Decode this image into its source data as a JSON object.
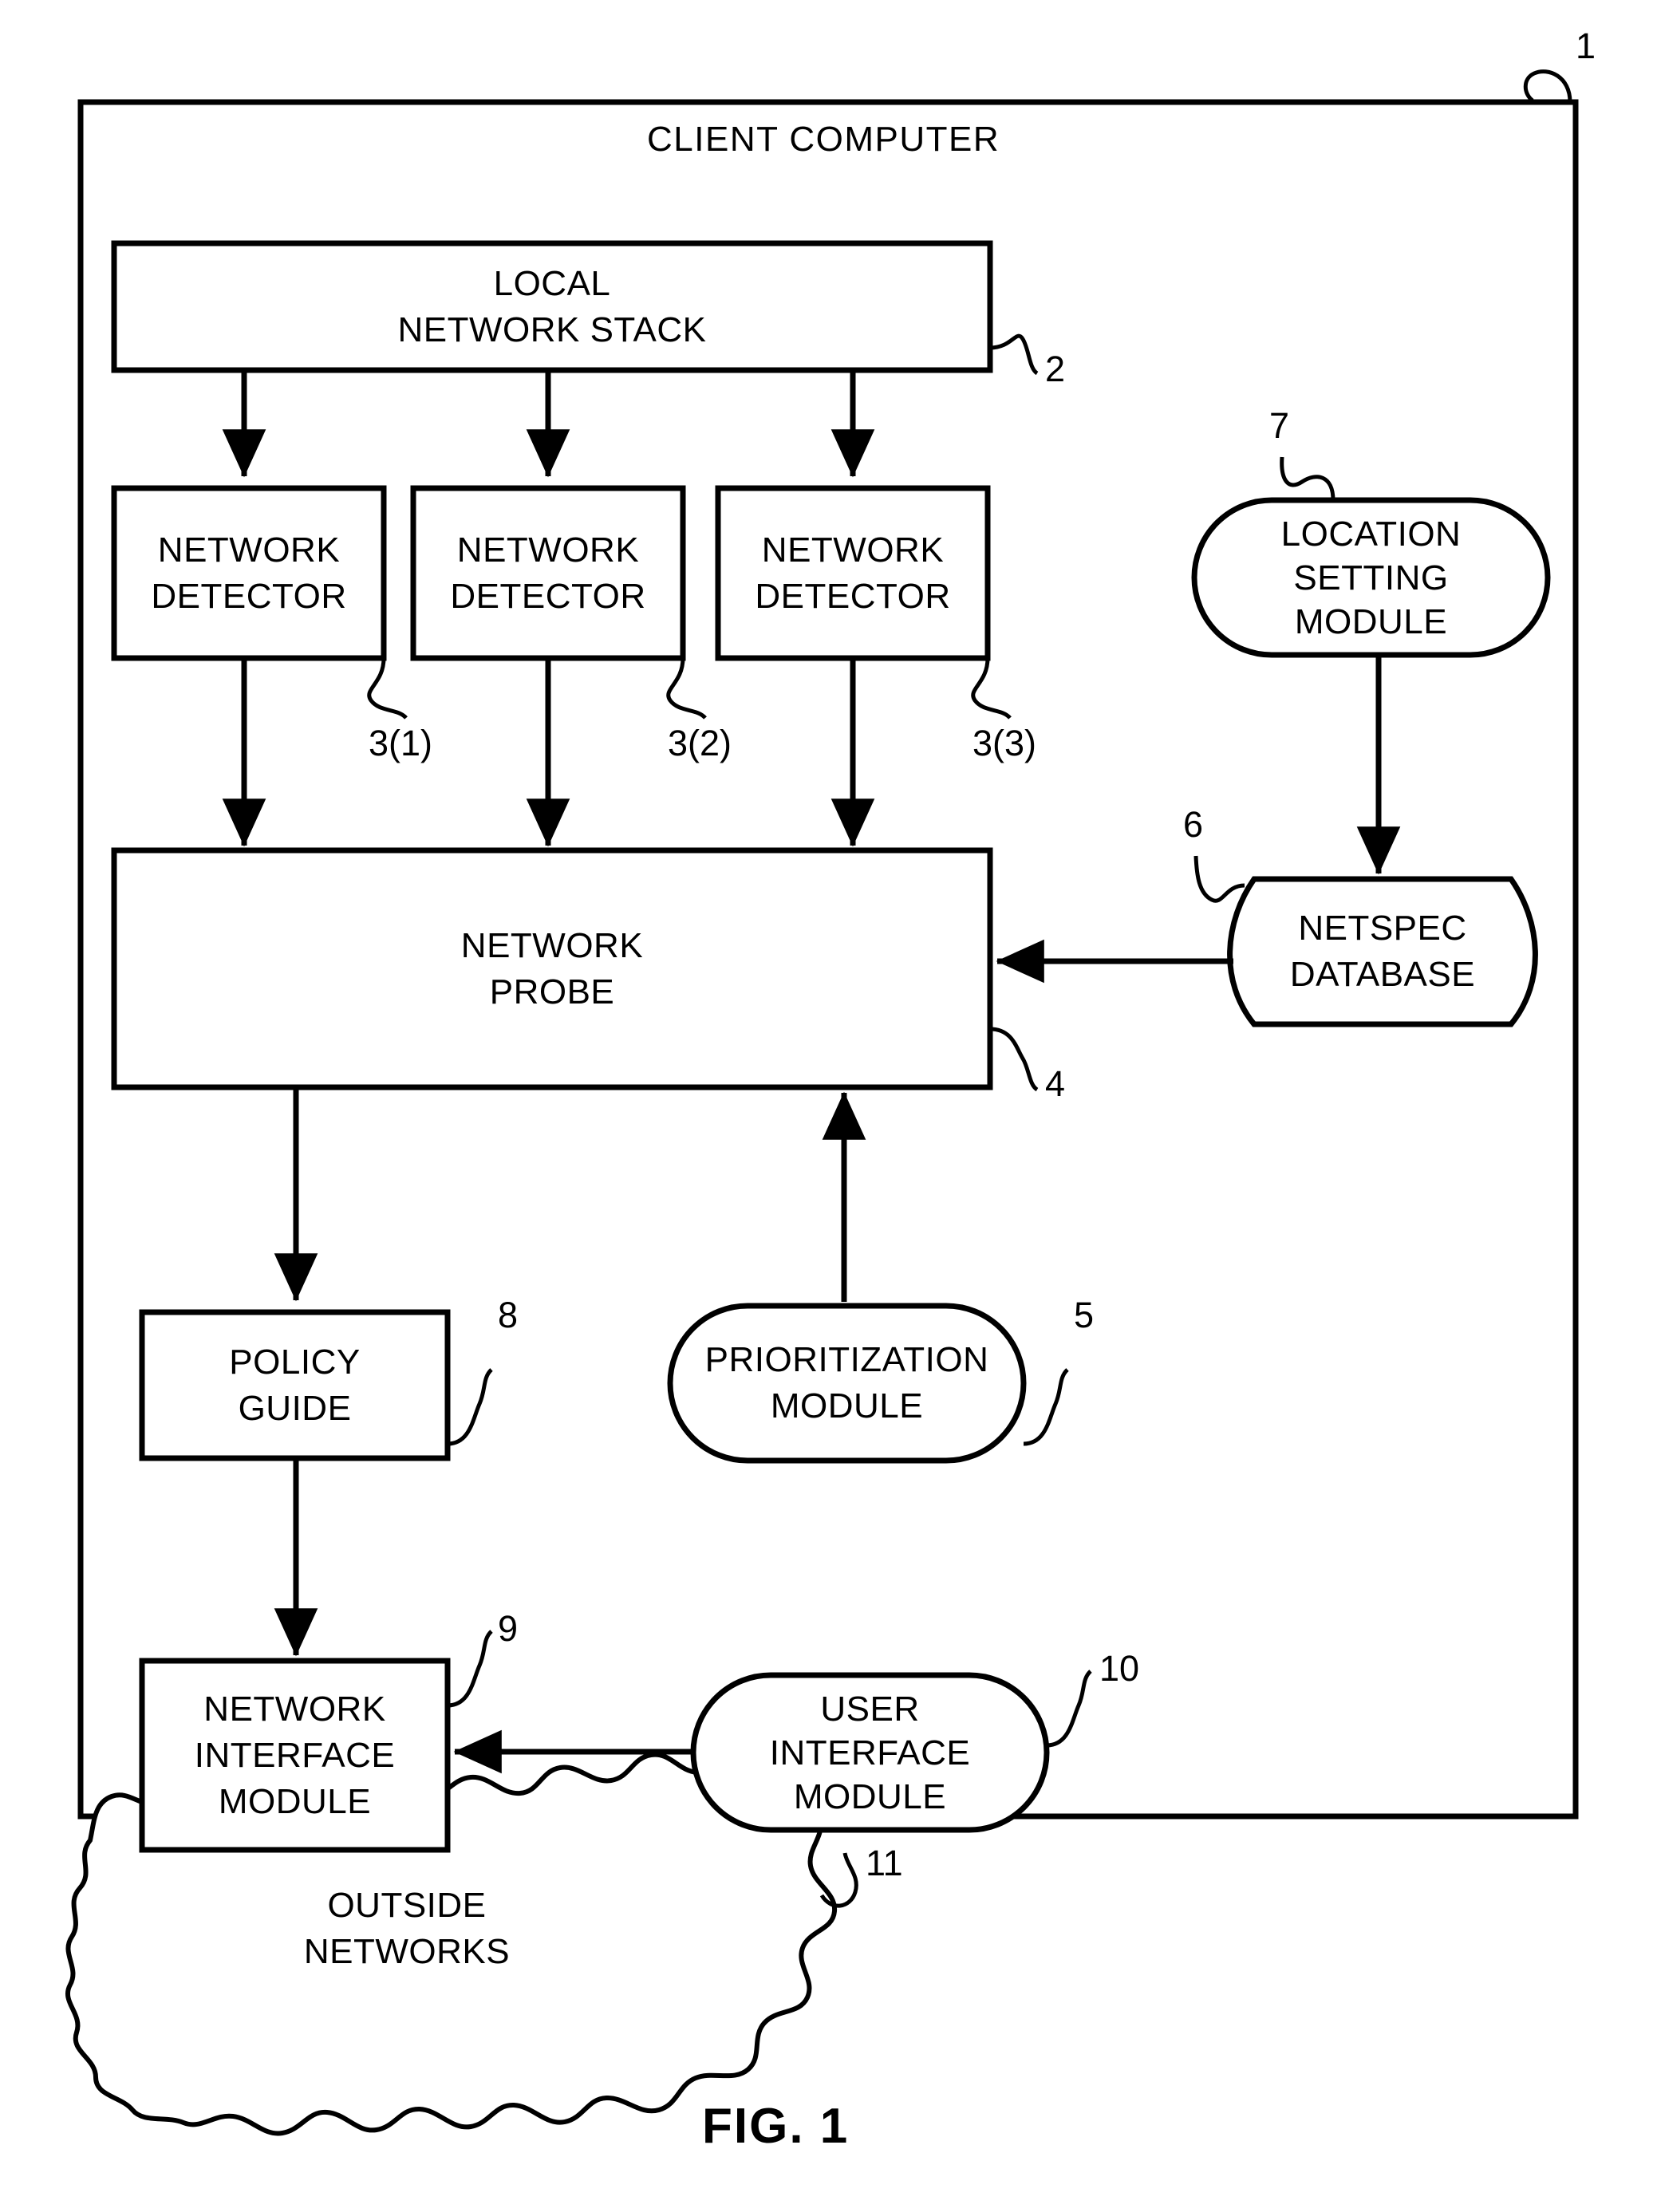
{
  "figure": {
    "caption": "FIG. 1",
    "outer_title": "CLIENT COMPUTER",
    "outer_ref": "1",
    "stroke_color": "#000000",
    "background_color": "#ffffff"
  },
  "nodes": {
    "client_computer": {
      "label": "CLIENT COMPUTER",
      "ref": "1",
      "shape": "rectangle"
    },
    "local_network_stack": {
      "line1": "LOCAL",
      "line2": "NETWORK STACK",
      "ref": "2",
      "shape": "rectangle"
    },
    "network_detector_1": {
      "line1": "NETWORK",
      "line2": "DETECTOR",
      "ref": "3(1)",
      "shape": "rectangle"
    },
    "network_detector_2": {
      "line1": "NETWORK",
      "line2": "DETECTOR",
      "ref": "3(2)",
      "shape": "rectangle"
    },
    "network_detector_3": {
      "line1": "NETWORK",
      "line2": "DETECTOR",
      "ref": "3(3)",
      "shape": "rectangle"
    },
    "network_probe": {
      "line1": "NETWORK",
      "line2": "PROBE",
      "ref": "4",
      "shape": "rectangle"
    },
    "prioritization_module": {
      "line1": "PRIORITIZATION",
      "line2": "MODULE",
      "ref": "5",
      "shape": "stadium"
    },
    "netspec_database": {
      "line1": "NETSPEC",
      "line2": "DATABASE",
      "ref": "6",
      "shape": "cylinder"
    },
    "location_setting_module": {
      "line1": "LOCATION",
      "line2": "SETTING",
      "line3": "MODULE",
      "ref": "7",
      "shape": "stadium"
    },
    "policy_guide": {
      "line1": "POLICY",
      "line2": "GUIDE",
      "ref": "8",
      "shape": "rectangle"
    },
    "network_interface_module": {
      "line1": "NETWORK",
      "line2": "INTERFACE",
      "line3": "MODULE",
      "ref": "9",
      "shape": "rectangle"
    },
    "user_interface_module": {
      "line1": "USER",
      "line2": "INTERFACE",
      "line3": "MODULE",
      "ref": "10",
      "shape": "stadium"
    },
    "outside_networks": {
      "line1": "OUTSIDE",
      "line2": "NETWORKS",
      "ref": "11",
      "shape": "cloud"
    }
  },
  "connections": [
    {
      "from": "local_network_stack",
      "to": "network_detector_1",
      "arrow": "down"
    },
    {
      "from": "local_network_stack",
      "to": "network_detector_2",
      "arrow": "down"
    },
    {
      "from": "local_network_stack",
      "to": "network_detector_3",
      "arrow": "down"
    },
    {
      "from": "network_detector_1",
      "to": "network_probe",
      "arrow": "down"
    },
    {
      "from": "network_detector_2",
      "to": "network_probe",
      "arrow": "down"
    },
    {
      "from": "network_detector_3",
      "to": "network_probe",
      "arrow": "down"
    },
    {
      "from": "location_setting_module",
      "to": "netspec_database",
      "arrow": "down"
    },
    {
      "from": "netspec_database",
      "to": "network_probe",
      "arrow": "left"
    },
    {
      "from": "network_probe",
      "to": "policy_guide",
      "arrow": "down"
    },
    {
      "from": "prioritization_module",
      "to": "network_probe",
      "arrow": "up"
    },
    {
      "from": "policy_guide",
      "to": "network_interface_module",
      "arrow": "down"
    },
    {
      "from": "user_interface_module",
      "to": "network_interface_module",
      "arrow": "left"
    }
  ]
}
